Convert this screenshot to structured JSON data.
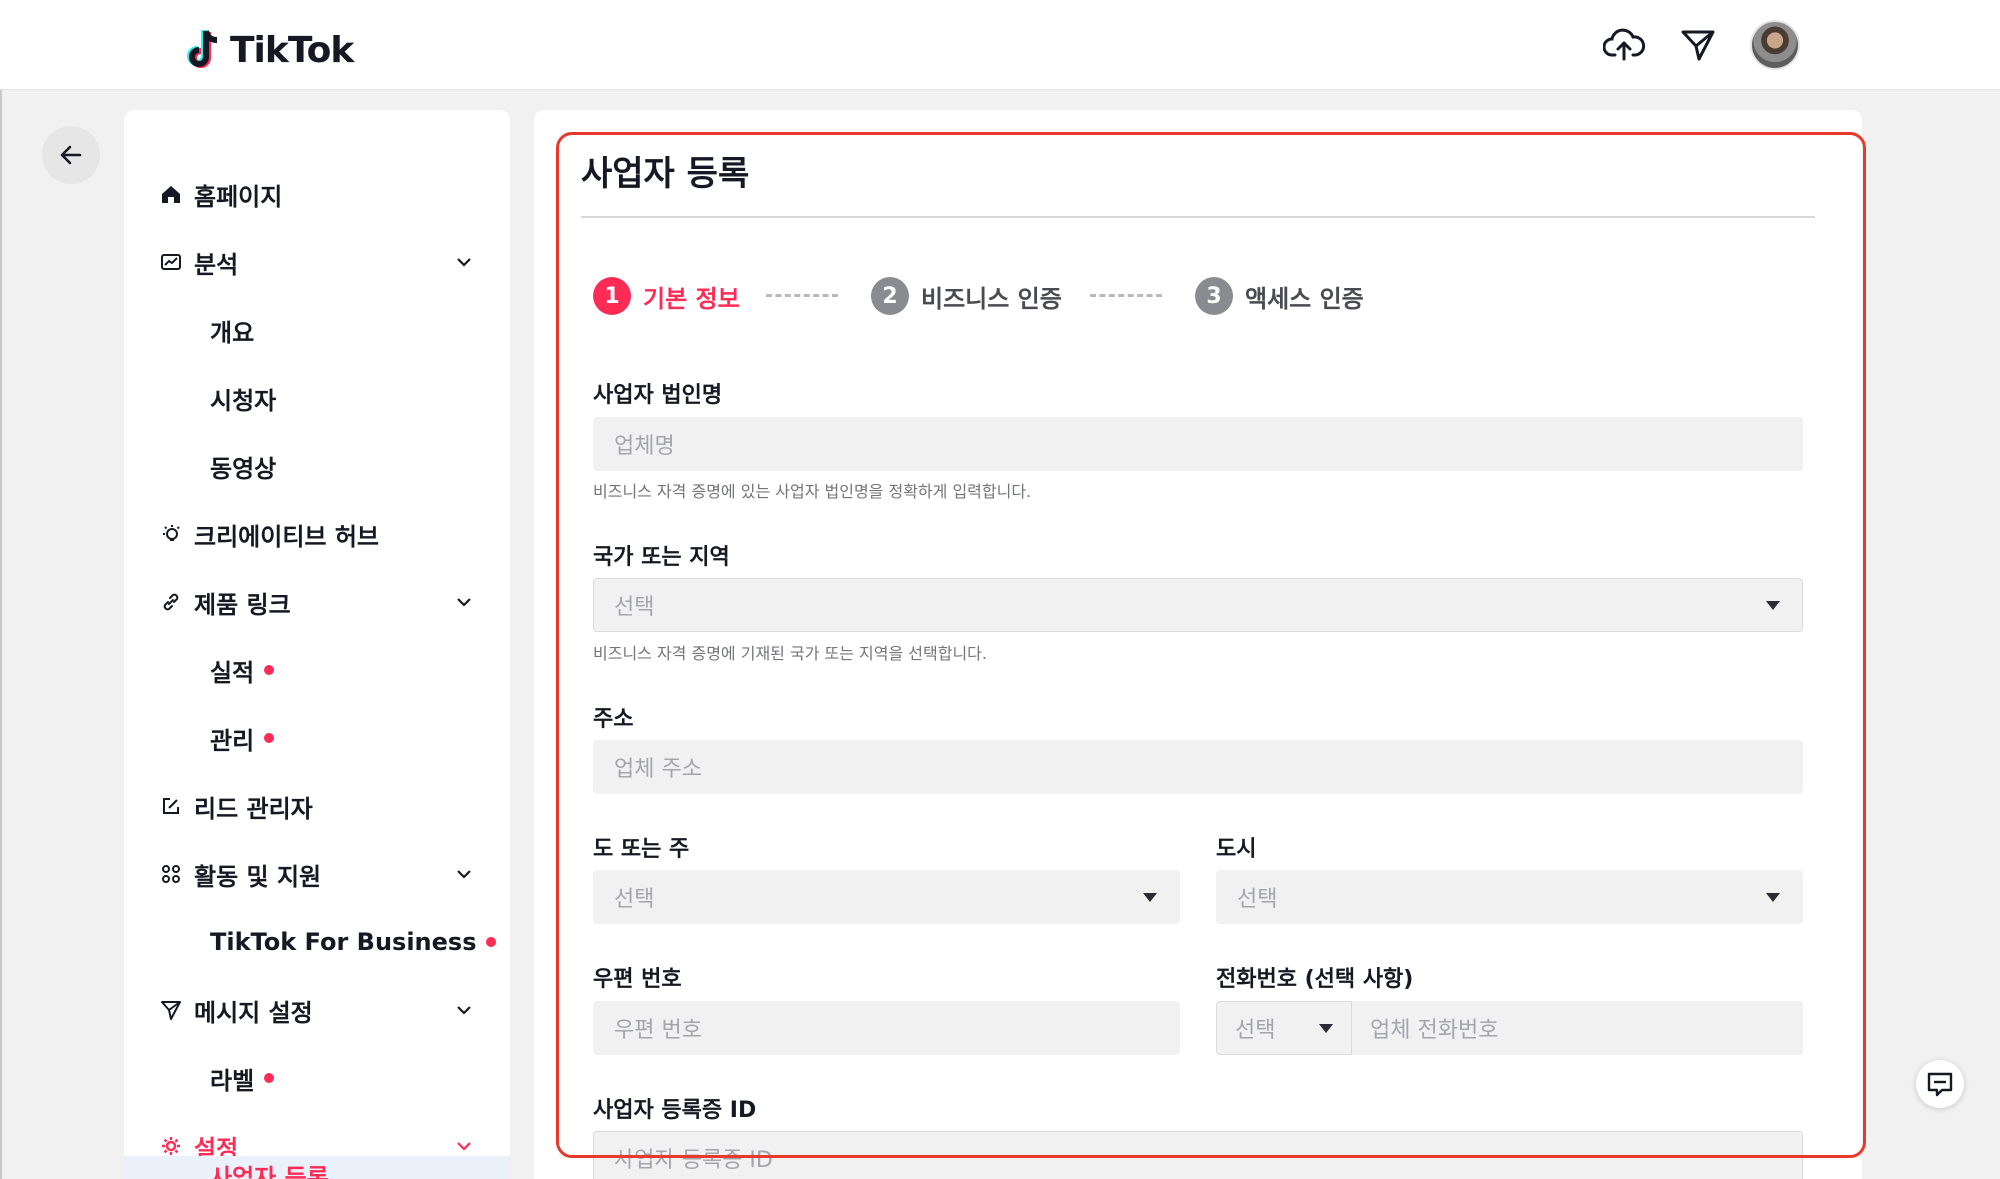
{
  "header": {
    "logo_text": "TikTok",
    "icons": [
      "upload-cloud-icon",
      "send-icon",
      "avatar"
    ]
  },
  "sidebar": {
    "items": [
      {
        "label": "홈페이지",
        "icon": "home-icon"
      },
      {
        "label": "분석",
        "icon": "analytics-icon",
        "expanded": true
      },
      {
        "label": "개요"
      },
      {
        "label": "시청자"
      },
      {
        "label": "동영상"
      },
      {
        "label": "크리에이티브 허브",
        "icon": "lightbulb-icon"
      },
      {
        "label": "제품 링크",
        "icon": "link-icon",
        "expanded": true
      },
      {
        "label": "실적",
        "badge": true
      },
      {
        "label": "관리",
        "badge": true
      },
      {
        "label": "리드 관리자",
        "icon": "edit-icon"
      },
      {
        "label": "활동 및 지원",
        "icon": "grid-icon",
        "expanded": true
      },
      {
        "label": "TikTok For Business",
        "badge": true
      },
      {
        "label": "메시지 설정",
        "icon": "send-icon",
        "expanded": true
      },
      {
        "label": "라벨",
        "badge": true
      },
      {
        "label": "설정",
        "icon": "gear-icon",
        "expanded": true,
        "active": true
      }
    ],
    "partial_item": "사업자 등록"
  },
  "page": {
    "title": "사업자 등록",
    "steps": [
      {
        "num": "1",
        "label": "기본 정보",
        "state": "active"
      },
      {
        "num": "2",
        "label": "비즈니스 인증",
        "state": "inactive"
      },
      {
        "num": "3",
        "label": "액세스 인증",
        "state": "inactive"
      }
    ]
  },
  "form": {
    "company_name": {
      "label": "사업자 법인명",
      "placeholder": "업체명",
      "help": "비즈니스 자격 증명에 있는 사업자 법인명을 정확하게 입력합니다."
    },
    "country": {
      "label": "국가 또는 지역",
      "placeholder": "선택",
      "help": "비즈니스 자격 증명에 기재된 국가 또는 지역을 선택합니다."
    },
    "address": {
      "label": "주소",
      "placeholder": "업체 주소"
    },
    "state": {
      "label": "도 또는 주",
      "placeholder": "선택"
    },
    "city": {
      "label": "도시",
      "placeholder": "선택"
    },
    "postal": {
      "label": "우편 번호",
      "placeholder": "우편 번호"
    },
    "phone": {
      "label": "전화번호 (선택 사항)",
      "code_placeholder": "선택",
      "placeholder": "업체 전화번호"
    },
    "reg_id": {
      "label": "사업자 등록증 ID",
      "placeholder": "사업자 등록증 ID"
    }
  },
  "colors": {
    "accent": "#fe2c55",
    "highlight_border": "#e8392d",
    "input_bg": "#f1f1f2"
  }
}
